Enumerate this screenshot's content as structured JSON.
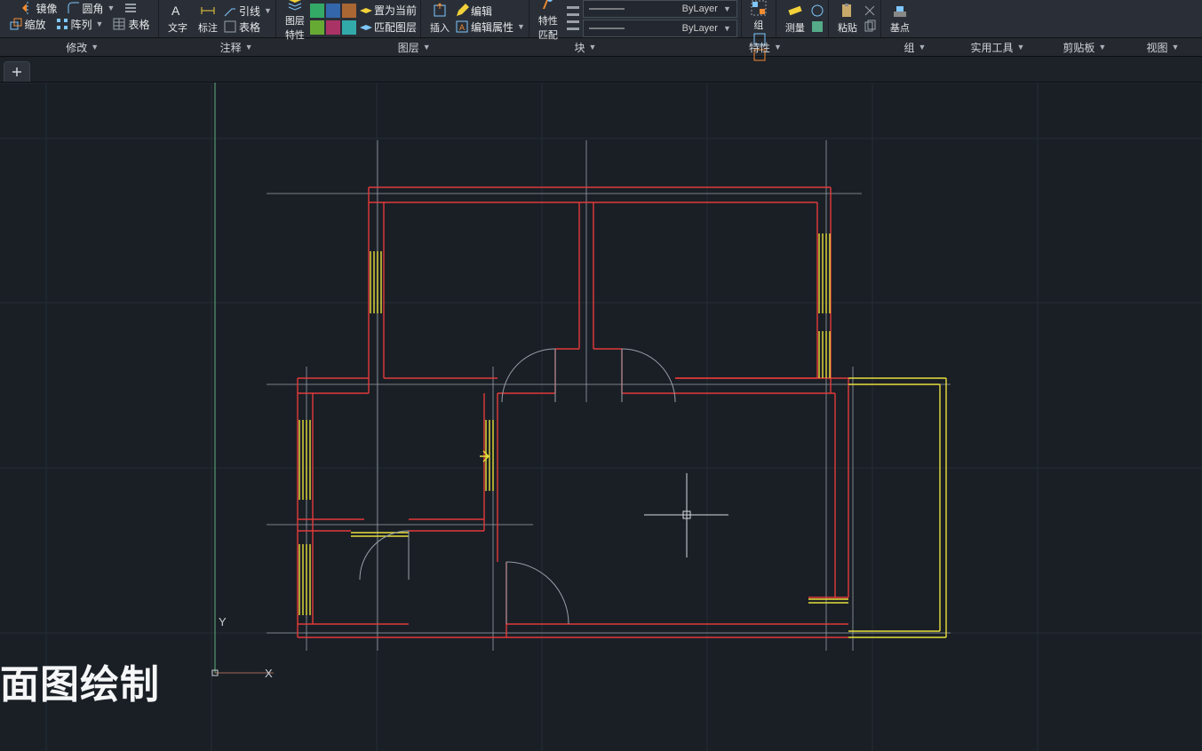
{
  "ribbon": {
    "panels": {
      "modify": {
        "label": "修改",
        "mirror": "镜像",
        "scale": "缩放",
        "fillet": "圆角",
        "array": "阵列",
        "table": "表格"
      },
      "annotate": {
        "label": "注释",
        "text": "文字",
        "dim": "标注",
        "leader": "引线"
      },
      "layers": {
        "label": "图层",
        "props": "图层\n特性",
        "setcur": "置为当前",
        "match": "匹配图层"
      },
      "blocks": {
        "label": "块",
        "insert": "插入",
        "edit": "编辑",
        "editattrs": "编辑属性"
      },
      "props": {
        "label": "特性",
        "match": "特性\n匹配",
        "layer1": "ByLayer",
        "layer2": "ByLayer"
      },
      "group": {
        "label": "组",
        "text": "组"
      },
      "util": {
        "label": "实用工具",
        "measure": "测量"
      },
      "clip": {
        "label": "剪贴板",
        "paste": "粘贴"
      },
      "view": {
        "label": "视图",
        "base": "基点"
      }
    }
  },
  "file_tabs": {
    "add": "+"
  },
  "axes": {
    "x": "X",
    "y": "Y"
  },
  "watermark": "面图绘制"
}
